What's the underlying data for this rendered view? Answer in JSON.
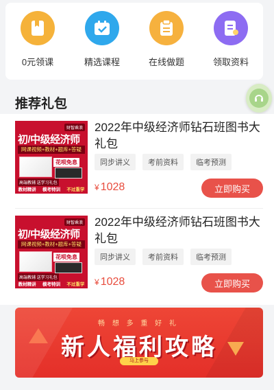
{
  "categories": [
    {
      "label": "0元领课",
      "icon": "bookmark-book-icon",
      "color": "#f5b23a"
    },
    {
      "label": "精选课程",
      "icon": "calendar-check-icon",
      "color": "#2fa8ec"
    },
    {
      "label": "在线做题",
      "icon": "clipboard-icon",
      "color": "#f6b13e"
    },
    {
      "label": "领取资料",
      "icon": "document-icon",
      "color": "#8d6cf2"
    }
  ],
  "section": {
    "title": "推荐礼包"
  },
  "products": [
    {
      "title": "2022年中级经济师钻石班图书大礼包",
      "tags": [
        "同步讲义",
        "考前资料",
        "临考预测"
      ],
      "currency": "¥",
      "price": "1028",
      "buy_label": "立即购买",
      "thumb": {
        "badge": "财智乘浪",
        "line1": "初/中级经济师",
        "line2": "网课视频+教材+题库+答疑",
        "line3": "花呗免息",
        "line4": "高端教辅 送学习礼包",
        "bottom": [
          "教材精讲",
          "模考特训",
          "不过重学"
        ]
      }
    },
    {
      "title": "2022年中级经济师钻石班图书大礼包",
      "tags": [
        "同步讲义",
        "考前资料",
        "临考预测"
      ],
      "currency": "¥",
      "price": "1028",
      "buy_label": "立即购买",
      "thumb": {
        "badge": "财智乘浪",
        "line1": "初/中级经济师",
        "line2": "网课视频+教材+题库+答疑",
        "line3": "花呗免息",
        "line4": "高端教辅 送学习礼包",
        "bottom": [
          "教材精讲",
          "模考特训",
          "不过重学"
        ]
      }
    }
  ],
  "banner": {
    "subtitle": "畅 想 多 重 好 礼",
    "title": "新人福利攻略",
    "cta": "马上参与"
  },
  "colors": {
    "accent": "#e8524a",
    "price": "#e84c3d"
  }
}
